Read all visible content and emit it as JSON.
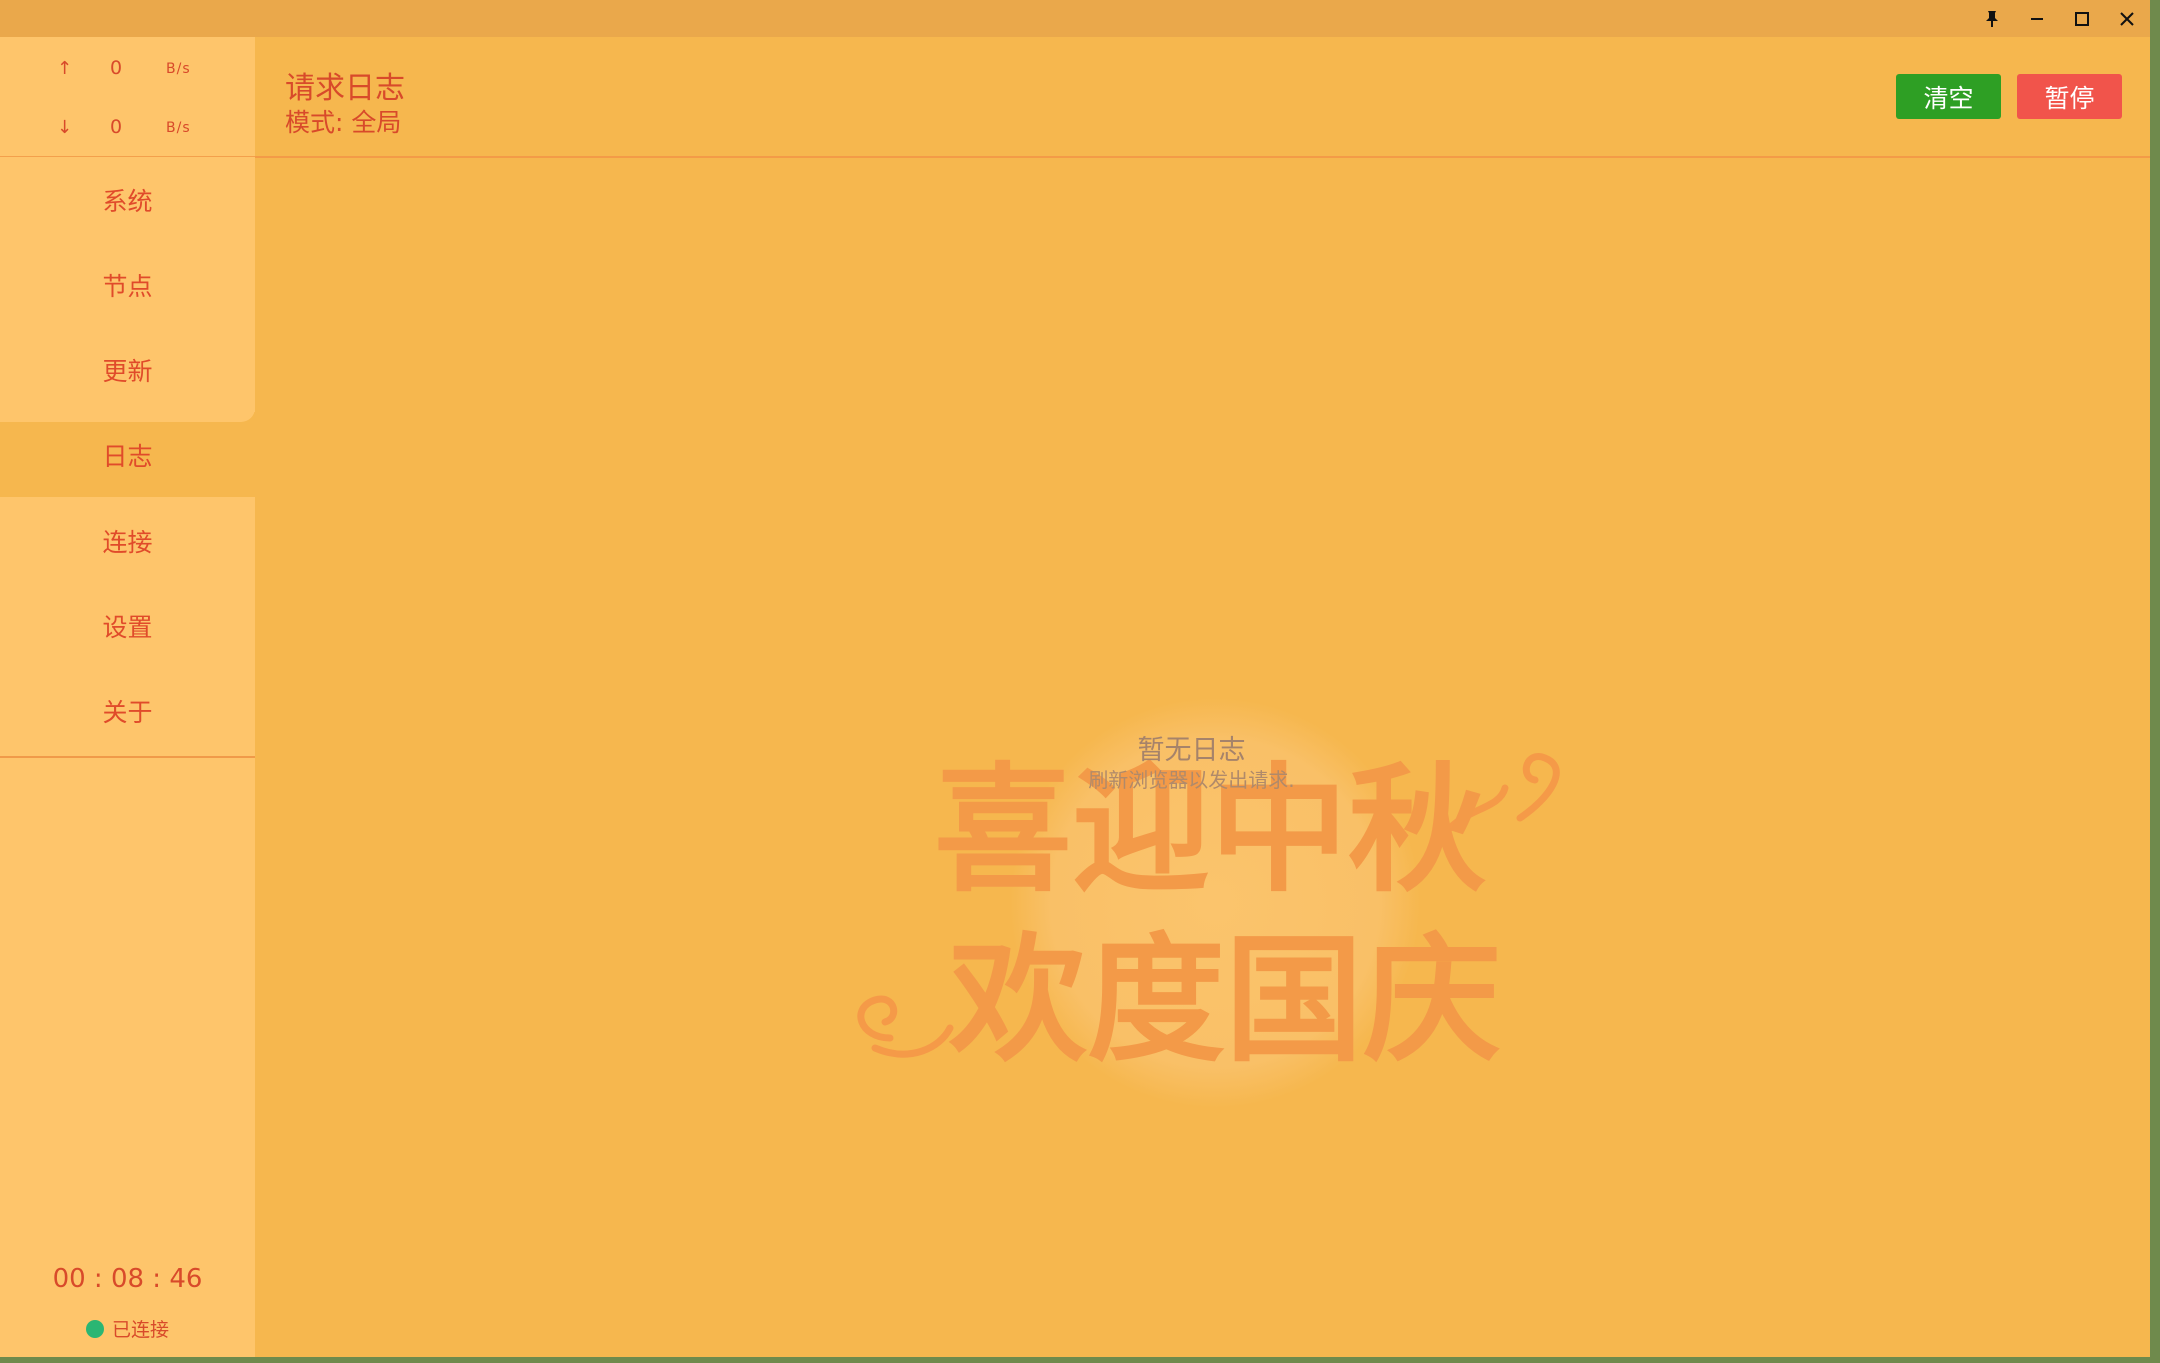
{
  "titlebar": {
    "buttons": [
      {
        "name": "pin-button",
        "icon": "pin-icon"
      },
      {
        "name": "minimize-button",
        "icon": "minimize-icon"
      },
      {
        "name": "maximize-button",
        "icon": "maximize-icon"
      },
      {
        "name": "close-button",
        "icon": "close-icon"
      }
    ]
  },
  "sidebar": {
    "traffic": {
      "up": {
        "arrow": "↑",
        "value": "0",
        "unit": "B/s"
      },
      "down": {
        "arrow": "↓",
        "value": "0",
        "unit": "B/s"
      }
    },
    "items": [
      {
        "label": "系统"
      },
      {
        "label": "节点"
      },
      {
        "label": "更新"
      },
      {
        "label": "日志",
        "active": true
      },
      {
        "label": "连接"
      },
      {
        "label": "设置"
      },
      {
        "label": "关于"
      }
    ],
    "timer": "00 : 08 : 46",
    "status": {
      "label": "已连接",
      "color": "#2bb673"
    }
  },
  "header": {
    "title": "请求日志",
    "mode": "模式: 全局",
    "clear_label": "清空",
    "pause_label": "暂停"
  },
  "content": {
    "empty_title": "暂无日志",
    "empty_subtitle": "刷新浏览器以发出请求.",
    "banner_line1": "喜迎中秋",
    "banner_line2": "欢度国庆"
  },
  "colors": {
    "accent": "#d84a2a",
    "background": "#f6b74e",
    "sidebar": "#fec56b",
    "clear_button": "#2e9f24",
    "pause_button": "#f1544b"
  }
}
